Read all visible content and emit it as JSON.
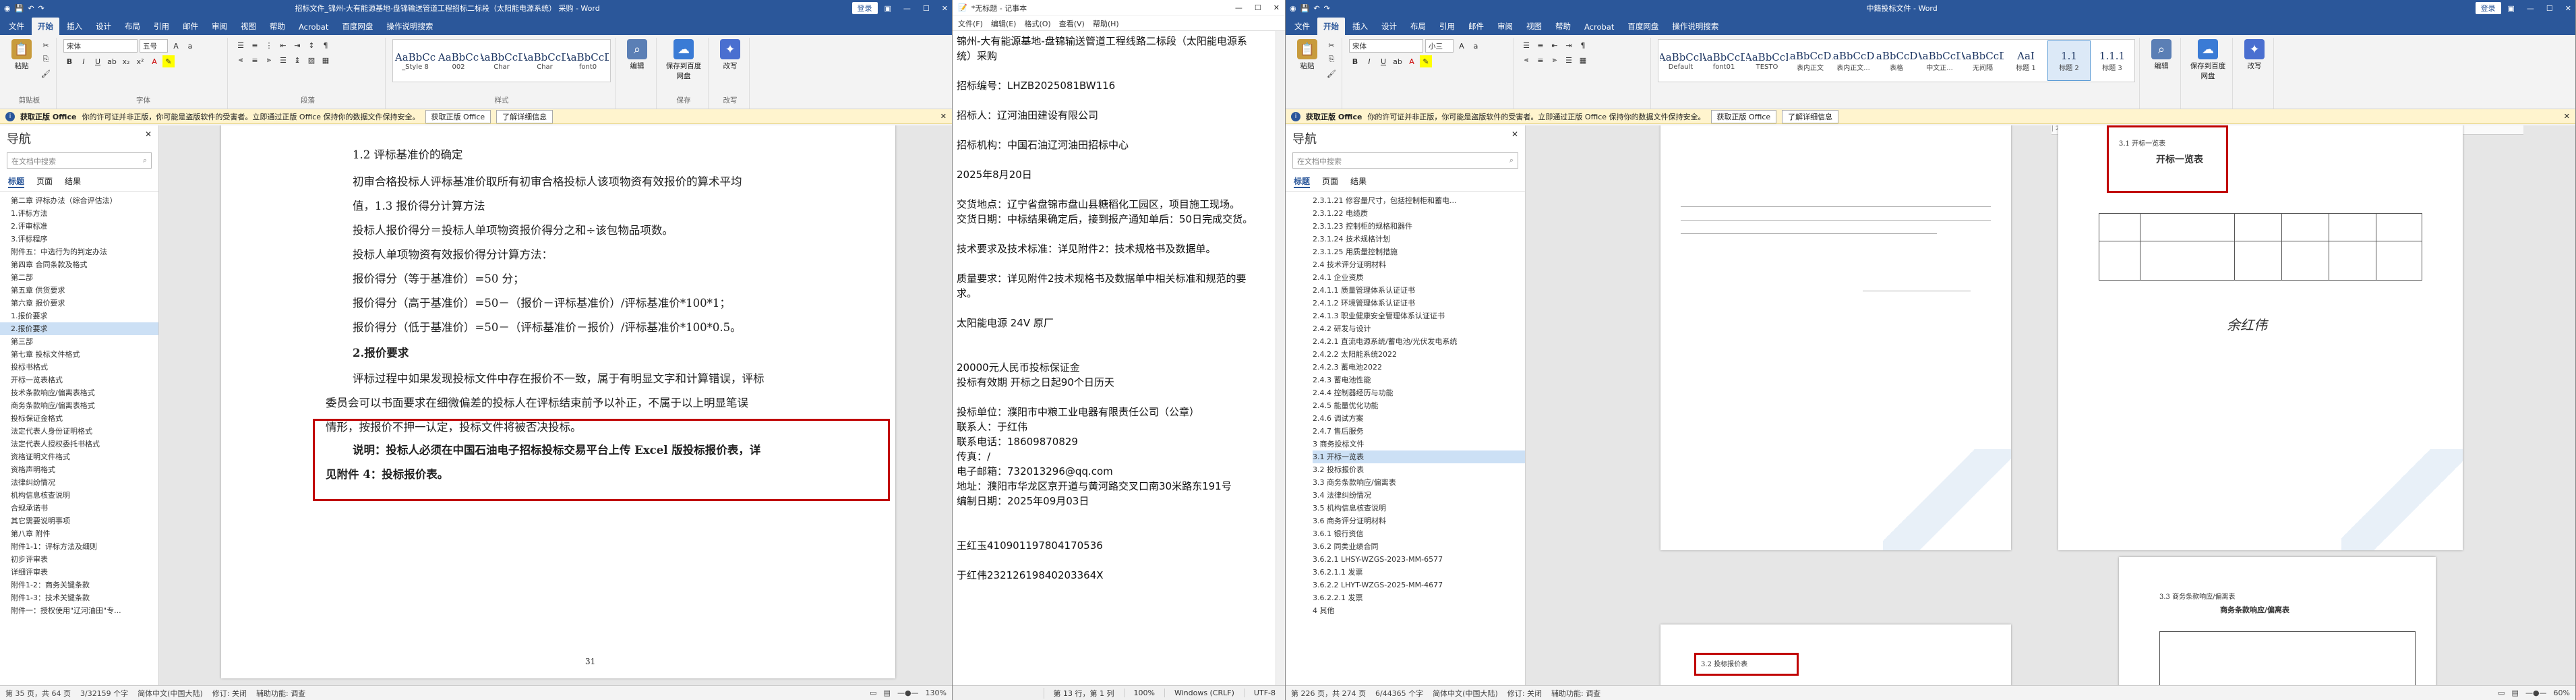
{
  "left": {
    "title": "招标文件_锦州-大有能源基地-盘锦输送管道工程招标二标段（太阳能电源系统） 采购 - Word",
    "login": "登录",
    "tabs": [
      "文件",
      "开始",
      "插入",
      "设计",
      "布局",
      "引用",
      "邮件",
      "审阅",
      "视图",
      "帮助",
      "Acrobat",
      "百度网盘",
      "操作说明搜索"
    ],
    "active_tab": "开始",
    "ribbon": {
      "paste": "粘贴",
      "clipboard": "剪贴板",
      "font_name": "宋体",
      "font_size": "五号",
      "font_group": "字体",
      "para_group": "段落",
      "styles_group": "样式",
      "styles": [
        {
          "sample": "AaBbCc",
          "name": "_Style 8"
        },
        {
          "sample": "AaBbCc",
          "name": "002"
        },
        {
          "sample": "AaBbCcD",
          "name": "Char"
        },
        {
          "sample": "AaBbCcD",
          "name": "Char"
        },
        {
          "sample": "AaBbCcD",
          "name": "font0"
        }
      ],
      "edit": "编辑",
      "save_baidu": "保存到百度网盘",
      "save_group": "保存",
      "rewrite": "改写",
      "rewrite_group": "改写"
    },
    "infobar": {
      "label": "获取正版 Office",
      "text": "你的许可证并非正版，你可能是盗版软件的受害者。立即通过正版 Office 保持你的数据文件保持安全。",
      "btn1": "获取正版 Office",
      "btn2": "了解详细信息"
    },
    "nav": {
      "title": "导航",
      "search": "在文档中搜索",
      "tabs": [
        "标题",
        "页面",
        "结果"
      ],
      "items": [
        "第二章 评标办法（综合评估法）",
        "1.评标方法",
        "2.评审标准",
        "3.评标程序",
        "附件五：中选行为的判定办法",
        "第四章 合同条款及格式",
        "第二部",
        "第五章 供货要求",
        "第六章 报价要求",
        "1.报价要求",
        "2.报价要求",
        "第三部",
        "第七章 投标文件格式",
        "投标书格式",
        "开标一览表格式",
        "技术条款响应/偏离表格式",
        "商务条款响应/偏离表格式",
        "投标保证金格式",
        "法定代表人身份证明格式",
        "法定代表人授权委托书格式",
        "资格证明文件格式",
        "资格声明格式",
        "法律纠纷情况",
        "机构信息核查说明",
        "合规承诺书",
        "其它需要说明事项",
        "第八章 附件",
        "附件1-1：评标方法及细则",
        "初步评审表",
        "详细评审表",
        "附件1-2：商务关键条款",
        "附件1-3：技术关键条款",
        "附件一：授权使用\"辽河油田\"专..."
      ],
      "highlight_index": 10
    },
    "doc": {
      "lines": [
        "1.2 评标基准价的确定",
        "初审合格投标人评标基准价取所有初审合格投标人该项物资有效报价的算术平均",
        "值，1.3 报价得分计算方法",
        "投标人报价得分＝投标人单项物资报价得分之和÷该包物品项数。",
        "投标人单项物资有效报价得分计算方法：",
        "报价得分（等于基准价）=50 分；",
        "报价得分（高于基准价）=50－（报价－评标基准价）/评标基准价*100*1；",
        "报价得分（低于基准价）=50－（评标基准价－报价）/评标基准价*100*0.5。",
        "2.报价要求",
        "评标过程中如果发现投标文件中存在报价不一致，属于有明显文字和计算错误，评标",
        "委员会可以书面要求在细微偏差的投标人在评标结束前予以补正，不属于以上明显笔误",
        "情形，按报价不押一认定，投标文件将被否决投标。"
      ],
      "note1": "说明：投标人必须在中国石油电子招标投标交易平台上传 Excel 版投标报价表，详",
      "note2": "见附件 4：投标报价表。",
      "pagenum": "31"
    },
    "status": {
      "page": "第 35 页，共 64 页",
      "words": "3/32159 个字",
      "lang": "简体中文(中国大陆)",
      "track": "修订: 关闭",
      "access": "辅助功能: 调查",
      "zoom": "130%"
    }
  },
  "notepad": {
    "title": "*无标题 - 记事本",
    "menu": [
      "文件(F)",
      "编辑(E)",
      "格式(O)",
      "查看(V)",
      "帮助(H)"
    ],
    "lines": [
      "锦州-大有能源基地-盘锦输送管道工程线路二标段（太阳能电源系",
      "统）采购",
      "",
      "招标编号：LHZB2025081BW116",
      "",
      "招标人：辽河油田建设有限公司",
      "",
      "招标机构：中国石油辽河油田招标中心",
      "",
      "2025年8月20日",
      "",
      "交货地点：辽宁省盘锦市盘山县糖稻化工园区，项目施工现场。",
      "交货日期：中标结果确定后，接到报产通知单后：50日完成交货。",
      "",
      "技术要求及技术标准：详见附件2：技术规格书及数据单。",
      "",
      "质量要求：详见附件2技术规格书及数据单中相关标准和规范的要",
      "求。",
      "",
      "太阳能电源 24V 原厂",
      "",
      "",
      "20000元人民币投标保证金",
      "投标有效期 开标之日起90个日历天",
      "",
      "投标单位：濮阳市中粮工业电器有限责任公司（公章）",
      "联系人：于红伟",
      "联系电话：18609870829",
      "传真：/",
      "电子邮箱：732013296@qq.com",
      "地址：濮阳市华龙区京开道与黄河路交叉口南30米路东191号",
      "编制日期：2025年09月03日",
      "",
      "",
      "王红玉410901197804170536",
      "",
      "于红伟23212619840203364X"
    ],
    "status": [
      "第 13 行，第 1 列",
      "100%",
      "Windows (CRLF)",
      "UTF-8"
    ]
  },
  "right": {
    "title": "中籍投标文件 - Word",
    "login": "登录",
    "tabs": [
      "文件",
      "开始",
      "插入",
      "设计",
      "布局",
      "引用",
      "邮件",
      "审阅",
      "视图",
      "帮助",
      "Acrobat",
      "百度网盘",
      "操作说明搜索"
    ],
    "active_tab": "开始",
    "ribbon": {
      "paste": "粘贴",
      "font_name": "宋体",
      "font_size": "小三",
      "styles": [
        {
          "sample": "AaBbCcI",
          "name": "Default"
        },
        {
          "sample": "AaBbCcD",
          "name": "font01"
        },
        {
          "sample": "AaBbCcI",
          "name": "TESTO"
        },
        {
          "sample": "AaBbCcDd",
          "name": "表内正文"
        },
        {
          "sample": "AaBbCcDd",
          "name": "表内正文..."
        },
        {
          "sample": "AaBbCcDd",
          "name": "表格"
        },
        {
          "sample": "AaBbCcD",
          "name": "中文正..."
        },
        {
          "sample": "AaBbCcD",
          "name": "无间隔"
        },
        {
          "sample": "AaI",
          "name": "标题 1"
        },
        {
          "sample": "1.1",
          "name": "标题 2"
        },
        {
          "sample": "1.1.1",
          "name": "标题 3"
        }
      ],
      "edit": "编辑",
      "save_baidu": "保存到百度网盘",
      "rewrite": "改写"
    },
    "infobar": {
      "label": "获取正版 Office",
      "text": "你的许可证并非正版，你可能是盗版软件的受害者。立即通过正版 Office 保持你的数据文件保持安全。",
      "btn1": "获取正版 Office",
      "btn2": "了解详细信息"
    },
    "nav": {
      "title": "导航",
      "search": "在文档中搜索",
      "tabs": [
        "标题",
        "页面",
        "结果"
      ],
      "items": [
        "2.3.1.21 修容量尺寸，包括控制柜和蓄电...",
        "2.3.1.22 电缆质",
        "2.3.1.23 控制柜的规格和器件",
        "2.3.1.24 技术规格计划",
        "2.3.1.25 用质量控制措施",
        "2.4 技术评分证明材料",
        "2.4.1 企业资质",
        "2.4.1.1 质量管理体系认证证书",
        "2.4.1.2 环境管理体系认证证书",
        "2.4.1.3 职业健康安全管理体系认证证书",
        "2.4.2 研发与设计",
        "2.4.2.1 直流电源系统/蓄电池/光伏发电系统",
        "2.4.2.2 太阳能系统2022",
        "2.4.2.3 蓄电池2022",
        "2.4.3 蓄电池性能",
        "2.4.4 控制器经历与功能",
        "2.4.5 能量优化功能",
        "2.4.6 调试方案",
        "2.4.7 售后服务",
        "3 商务投标文件",
        "3.1 开标一览表",
        "3.2 投标报价表",
        "3.3 商务条款响应/偏离表",
        "3.4 法律纠纷情况",
        "3.5 机构信息核查说明",
        "3.6 商务评分证明材料",
        "3.6.1 银行资信",
        "3.6.2 同类业绩合同",
        "3.6.2.1 LHSY-WZGS-2023-MM-6577",
        "3.6.2.1.1 发票",
        "3.6.2.2 LHYT-WZGS-2025-MM-4677",
        "3.6.2.2.1 发票",
        "4 其他"
      ],
      "highlight_index": 20
    },
    "doc": {
      "h1": "3.1 开标一览表",
      "h1title": "开标一览表",
      "h2": "3.2 投标报价表",
      "h3": "3.3 商务条款响应/偏离表",
      "h3title": "商务条款响应/偏离表",
      "sig": "余红伟"
    },
    "status": {
      "page": "第 226 页，共 274 页",
      "words": "6/44365 个字",
      "lang": "简体中文(中国大陆)",
      "track": "修订: 关闭",
      "access": "辅助功能: 调查",
      "zoom": "60%"
    }
  }
}
